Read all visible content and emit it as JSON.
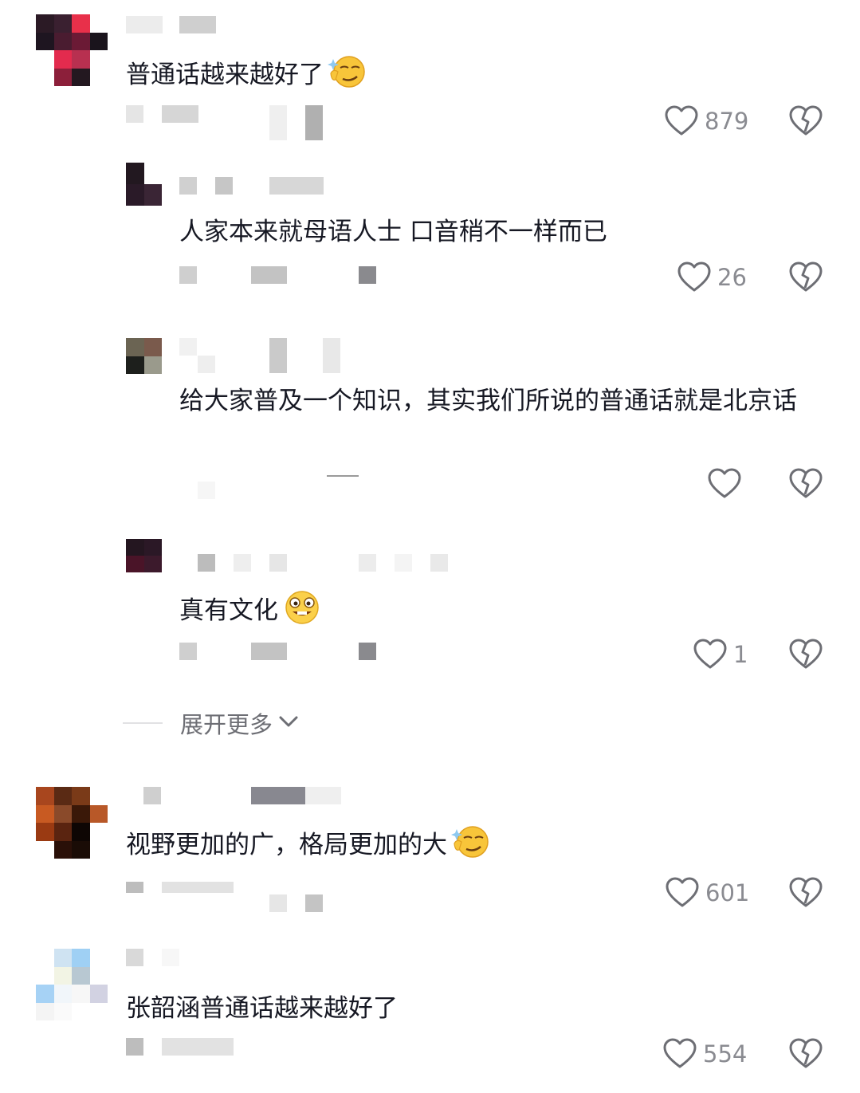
{
  "comments": [
    {
      "text": "普通话越来越好了",
      "emoji": "smirk-emoji",
      "likes": "879"
    },
    {
      "text": "人家本来就母语人士 口音稍不一样而已",
      "likes": "26"
    },
    {
      "text": "给大家普及一个知识，其实我们所说的普通话就是北京话",
      "likes": ""
    },
    {
      "text": "真有文化",
      "emoji": "grin-emoji",
      "likes": "1"
    },
    {
      "text": "视野更加的广，格局更加的大",
      "emoji": "smirk-emoji",
      "likes": "601"
    },
    {
      "text": "张韶涵普通话越来越好了",
      "likes": "554"
    }
  ],
  "expand": {
    "label": "展开更多"
  },
  "icons": {
    "like": "heart-outline-icon",
    "dislike": "broken-heart-icon",
    "expand": "chevron-down-icon"
  },
  "colors": {
    "text": "#161823",
    "meta": "#8a8b91",
    "icon": "#6d6e74"
  }
}
